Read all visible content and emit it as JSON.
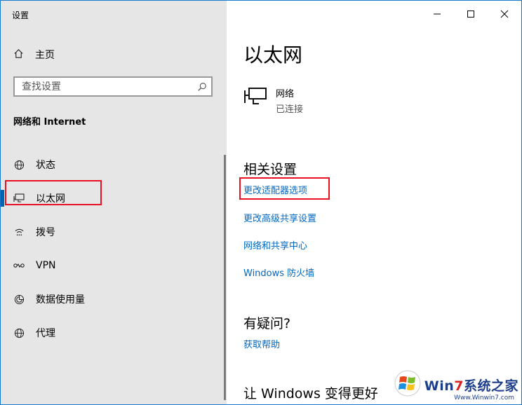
{
  "window": {
    "app_title": "设置",
    "controls": {
      "minimize": "minimize",
      "maximize": "maximize",
      "close": "close"
    }
  },
  "sidebar": {
    "home_label": "主页",
    "search": {
      "placeholder": "查找设置",
      "value": ""
    },
    "section_title": "网络和 Internet",
    "items": [
      {
        "icon": "globe-status-icon",
        "label": "状态",
        "selected": false
      },
      {
        "icon": "ethernet-icon",
        "label": "以太网",
        "selected": true
      },
      {
        "icon": "dialup-icon",
        "label": "拨号",
        "selected": false
      },
      {
        "icon": "vpn-icon",
        "label": "VPN",
        "selected": false
      },
      {
        "icon": "data-usage-icon",
        "label": "数据使用量",
        "selected": false
      },
      {
        "icon": "proxy-globe-icon",
        "label": "代理",
        "selected": false
      }
    ]
  },
  "main": {
    "title": "以太网",
    "network": {
      "name": "网络",
      "status": "已连接"
    },
    "related": {
      "title": "相关设置",
      "links": [
        "更改适配器选项",
        "更改高级共享设置",
        "网络和共享中心",
        "Windows 防火墙"
      ]
    },
    "help": {
      "title": "有疑问?",
      "link": "获取帮助"
    },
    "improve": {
      "title": "让 Windows 变得更好"
    }
  },
  "annotations": {
    "highlight_color": "#e81123"
  },
  "colors": {
    "accent": "#0063b1",
    "link": "#0067c0",
    "sidebar_bg": "#e6e6e6"
  },
  "watermark": {
    "part1": "Win",
    "part2": "7",
    "part3": "系统之家",
    "url": "Www.Winwin7.com"
  }
}
